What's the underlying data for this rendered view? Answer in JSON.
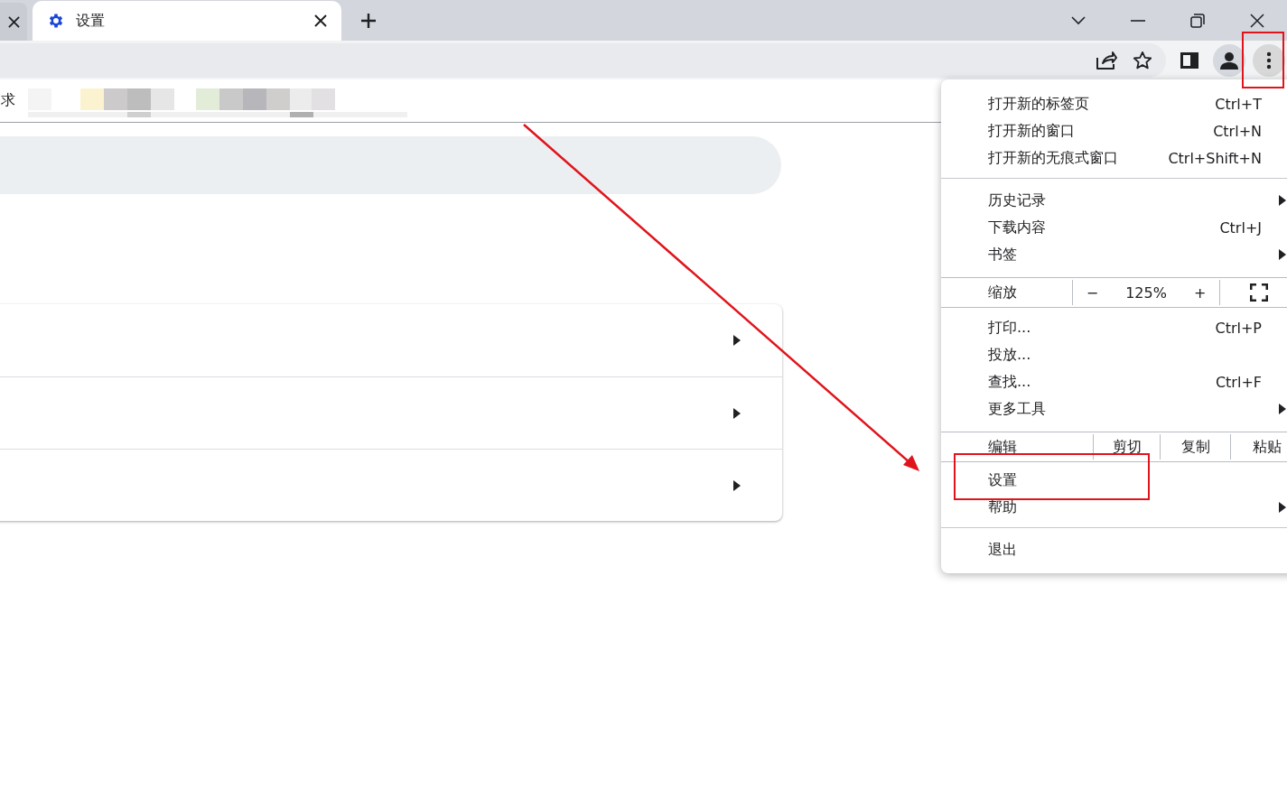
{
  "tabs": [
    {
      "label": "设置",
      "selected": true
    }
  ],
  "bookmarks_bar": {
    "text": "求"
  },
  "content_card": {
    "rows": [
      {
        "expandable": true
      },
      {
        "expandable": true
      },
      {
        "expandable": true
      }
    ]
  },
  "menu": {
    "items": [
      {
        "kind": "item",
        "label": "打开新的标签页",
        "shortcut": "Ctrl+T",
        "submenu": false
      },
      {
        "kind": "item",
        "label": "打开新的窗口",
        "shortcut": "Ctrl+N",
        "submenu": false
      },
      {
        "kind": "item",
        "label": "打开新的无痕式窗口",
        "shortcut": "Ctrl+Shift+N",
        "submenu": false
      },
      {
        "kind": "separator"
      },
      {
        "kind": "item",
        "label": "历史记录",
        "submenu": true
      },
      {
        "kind": "item",
        "label": "下载内容",
        "shortcut": "Ctrl+J",
        "submenu": false
      },
      {
        "kind": "item",
        "label": "书签",
        "submenu": true
      },
      {
        "kind": "zoom",
        "label": "缩放",
        "minus": "−",
        "value": "125%",
        "plus": "+"
      },
      {
        "kind": "item",
        "label": "打印...",
        "shortcut": "Ctrl+P",
        "submenu": false
      },
      {
        "kind": "item",
        "label": "投放...",
        "submenu": false
      },
      {
        "kind": "item",
        "label": "查找...",
        "shortcut": "Ctrl+F",
        "submenu": false
      },
      {
        "kind": "item",
        "label": "更多工具",
        "submenu": true
      },
      {
        "kind": "edit",
        "label": "编辑",
        "actions": [
          "剪切",
          "复制",
          "粘贴"
        ]
      },
      {
        "kind": "item",
        "label": "设置",
        "submenu": false
      },
      {
        "kind": "item",
        "label": "帮助",
        "submenu": true
      },
      {
        "kind": "separator"
      },
      {
        "kind": "item",
        "label": "退出",
        "submenu": false
      }
    ]
  }
}
